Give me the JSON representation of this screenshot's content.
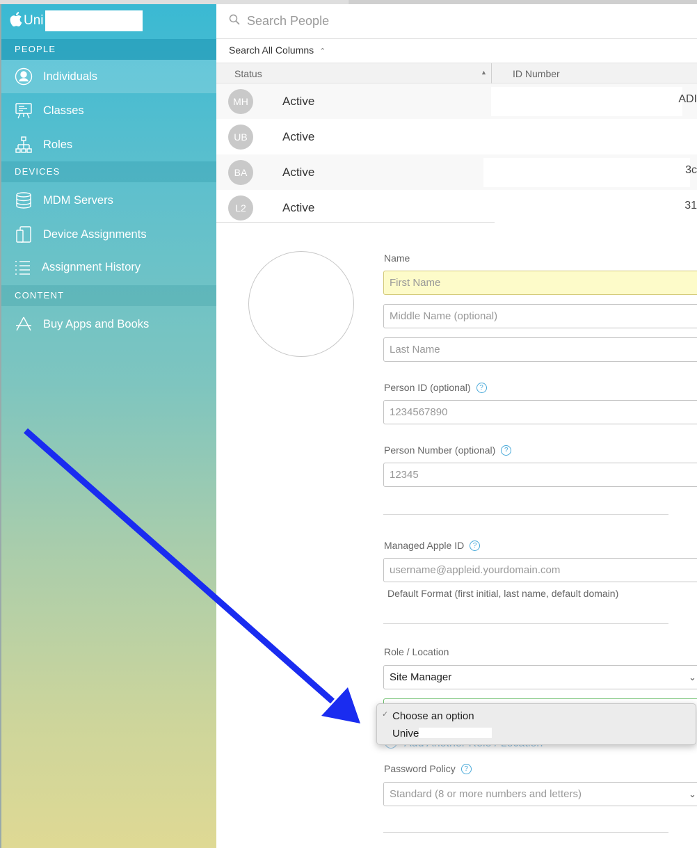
{
  "sidebar": {
    "brand_prefix": "Uni",
    "sections": {
      "people": "PEOPLE",
      "devices": "DEVICES",
      "content": "CONTENT"
    },
    "items": [
      {
        "label": "Individuals",
        "icon": "person-icon",
        "active": true
      },
      {
        "label": "Classes",
        "icon": "easel-icon",
        "active": false
      },
      {
        "label": "Roles",
        "icon": "hierarchy-icon",
        "active": false
      },
      {
        "label": "MDM Servers",
        "icon": "database-icon",
        "active": false
      },
      {
        "label": "Device Assignments",
        "icon": "devices-icon",
        "active": false
      },
      {
        "label": "Assignment History",
        "icon": "list-icon",
        "active": false
      },
      {
        "label": "Buy Apps and Books",
        "icon": "app-store-icon",
        "active": false
      }
    ]
  },
  "search": {
    "placeholder": "Search People"
  },
  "filter": {
    "label": "Search All Columns",
    "chevron": "⌃⌄"
  },
  "table": {
    "columns": [
      "Status",
      "ID Number"
    ],
    "sort_indicator": "▲",
    "rows": [
      {
        "initials": "MH",
        "status": "Active",
        "id_fragment": "ADI"
      },
      {
        "initials": "UB",
        "status": "Active",
        "id_fragment": ""
      },
      {
        "initials": "BA",
        "status": "Active",
        "id_fragment": "3c"
      },
      {
        "initials": "L2",
        "status": "Active",
        "id_fragment": "31"
      }
    ]
  },
  "form": {
    "name_label": "Name",
    "first_name_placeholder": "First Name",
    "middle_name_placeholder": "Middle Name (optional)",
    "last_name_placeholder": "Last Name",
    "person_id_label": "Person ID (optional)",
    "person_id_placeholder": "1234567890",
    "person_number_label": "Person Number (optional)",
    "person_number_placeholder": "12345",
    "managed_apple_id_label": "Managed Apple ID",
    "managed_apple_id_placeholder": "username@appleid.yourdomain.com",
    "managed_apple_id_hint": "Default Format (first initial, last name, default domain)",
    "role_location_label": "Role / Location",
    "role_value": "Site Manager",
    "add_role_link": "Add Another Role / Location",
    "password_policy_label": "Password Policy",
    "password_policy_value": "Standard (8 or more numbers and letters)",
    "help_glyph": "?"
  },
  "location_dropdown": {
    "checkmark": "✓",
    "options": [
      "Choose an option",
      "Unive"
    ]
  },
  "colors": {
    "sidebar_top": "#3ab9d3",
    "sidebar_bottom": "#dfd994",
    "highlight_field": "#fdfbc9",
    "arrow": "#1a2cf0",
    "help_blue": "#48a9d9"
  }
}
